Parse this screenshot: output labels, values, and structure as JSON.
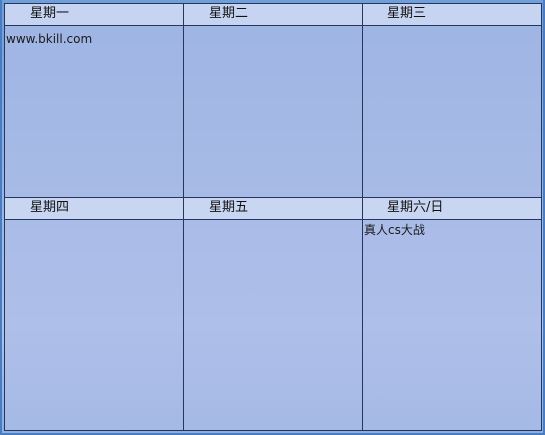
{
  "schedule": {
    "days": [
      {
        "label": "星期一",
        "entry": "www.bkill.com"
      },
      {
        "label": "星期二",
        "entry": ""
      },
      {
        "label": "星期三",
        "entry": ""
      },
      {
        "label": "星期四",
        "entry": ""
      },
      {
        "label": "星期五",
        "entry": ""
      },
      {
        "label": "星期六/日",
        "entry": "真人cs大战"
      }
    ]
  }
}
